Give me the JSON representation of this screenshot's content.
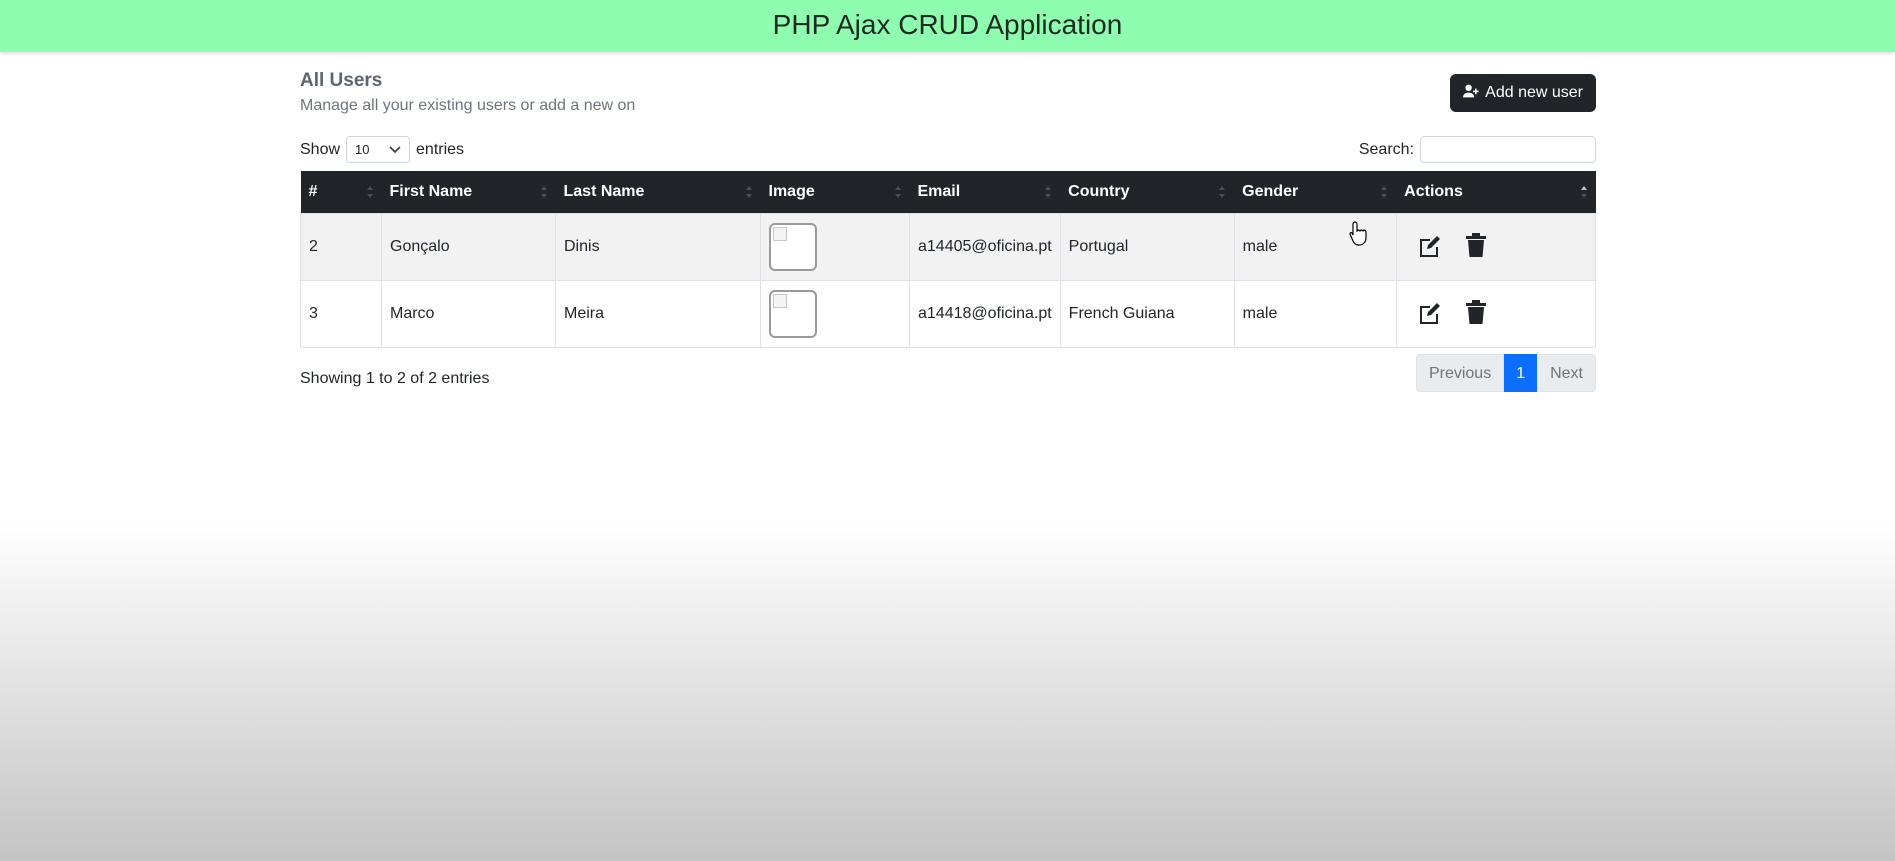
{
  "app": {
    "title": "PHP Ajax CRUD Application"
  },
  "page": {
    "heading": "All Users",
    "subheading": "Manage all your existing users or add a new on",
    "add_button": "Add new user"
  },
  "controls": {
    "show_label": "Show",
    "entries_value": "10",
    "entries_label": "entries",
    "search_label": "Search:",
    "search_value": ""
  },
  "table": {
    "columns": [
      "#",
      "First Name",
      "Last Name",
      "Image",
      "Email",
      "Country",
      "Gender",
      "Actions"
    ],
    "rows": [
      {
        "id": "2",
        "first_name": "Gonçalo",
        "last_name": "Dinis",
        "email": "a14405@oficina.pt",
        "country": "Portugal",
        "gender": "male"
      },
      {
        "id": "3",
        "first_name": "Marco",
        "last_name": "Meira",
        "email": "a14418@oficina.pt",
        "country": "French Guiana",
        "gender": "male"
      }
    ]
  },
  "footer": {
    "info": "Showing 1 to 2 of 2 entries",
    "previous": "Previous",
    "page": "1",
    "next": "Next"
  },
  "colors": {
    "header_bar": "#8ffdb0",
    "table_header": "#212529",
    "active_page": "#0d6efd"
  }
}
